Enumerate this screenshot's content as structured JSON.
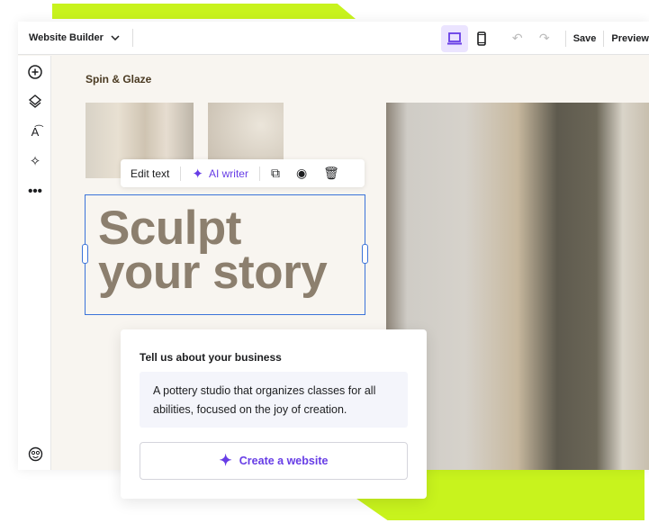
{
  "toolbar": {
    "app_name": "Website Builder",
    "save_label": "Save",
    "preview_label": "Preview",
    "active_device": "desktop"
  },
  "sidebar": {
    "icons": [
      "add-icon",
      "layers-icon",
      "styles-icon",
      "ai-sparkle-icon",
      "more-icon",
      "emoji-icon"
    ]
  },
  "site": {
    "name": "Spin & Glaze",
    "headline_line1": "Sculpt",
    "headline_line2": "your story"
  },
  "edit_toolbar": {
    "edit_text": "Edit text",
    "ai_writer": "AI writer"
  },
  "card": {
    "title": "Tell us about your business",
    "description": "A pottery studio that organizes classes for all abilities, focused on the joy of creation.",
    "create_button": "Create a website"
  },
  "colors": {
    "accent": "#673de6",
    "lime": "#c8f31d",
    "headline": "#8c7f6e",
    "selection": "#3b73d9"
  }
}
